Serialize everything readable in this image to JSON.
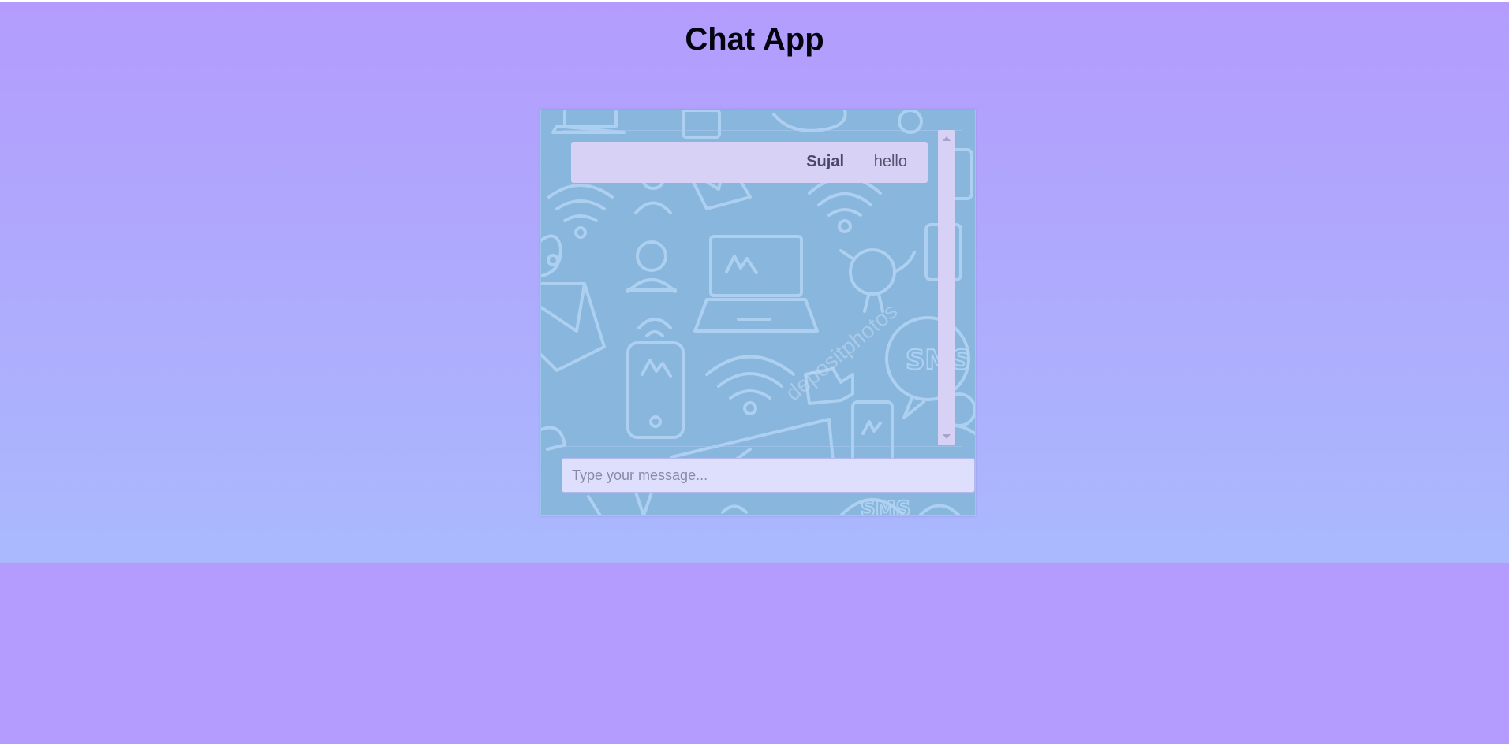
{
  "app": {
    "title": "Chat App"
  },
  "chat": {
    "messages": [
      {
        "user": "Sujal",
        "text": "hello"
      }
    ],
    "background_watermark": "depositphotos"
  },
  "composer": {
    "placeholder": "Type your message...",
    "value": ""
  },
  "colors": {
    "page_background": "#b39cfd",
    "gradient_bottom": "#aab9fd",
    "chat_background": "#88b6dc",
    "message_bubble": "#d7d1f5",
    "input_background": "#dedffd"
  }
}
